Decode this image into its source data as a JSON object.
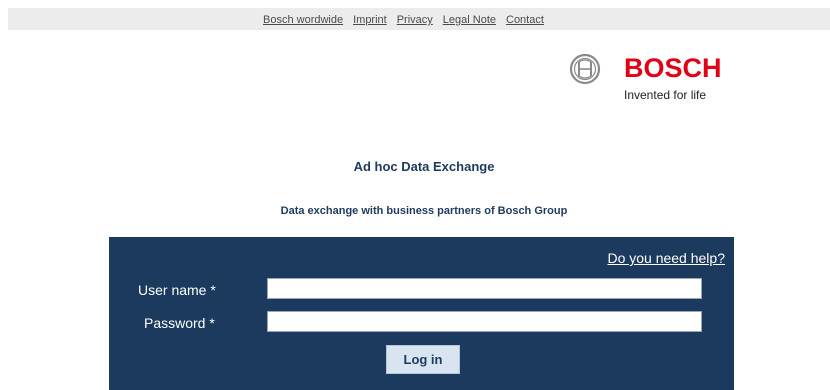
{
  "topnav": {
    "links": [
      "Bosch wordwide",
      "Imprint",
      "Privacy",
      "Legal Note",
      "Contact"
    ]
  },
  "logo": {
    "brand": "BOSCH",
    "tagline": "Invented for life",
    "brand_color": "#e20015"
  },
  "page": {
    "title": "Ad hoc Data Exchange",
    "subtitle": "Data exchange with business partners of Bosch Group"
  },
  "login": {
    "help_link": "Do you need help?",
    "username_label": "User name *",
    "username_value": "",
    "password_label": "Password *",
    "password_value": "",
    "submit_label": "Log in",
    "panel_color": "#1b3a5e"
  }
}
